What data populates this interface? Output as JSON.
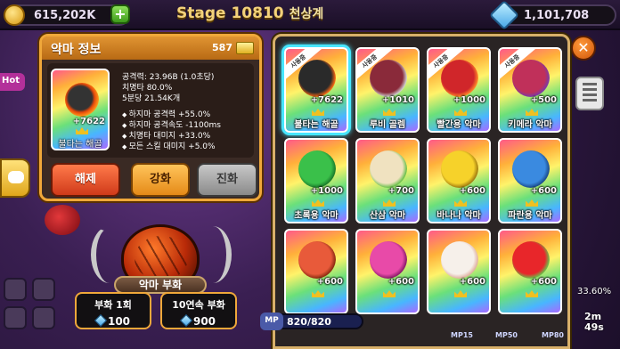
{
  "hud": {
    "gold": "615,202K",
    "stage": "Stage 10810",
    "stage_name": "천상계",
    "gems": "1,101,708",
    "hot_label": "Hot",
    "mp": "820/820",
    "mp_tag": "MP",
    "skills": [
      "MP15",
      "MP50",
      "MP80"
    ],
    "timer": [
      "2m",
      "49s"
    ],
    "percent": "33.60%"
  },
  "info": {
    "title": "악마 정보",
    "count": "587",
    "portrait_level": "+7622",
    "portrait_name": "불타는 해골",
    "stats": [
      "공격력: 23.96B (1.0초당)",
      "치명타 80.0%",
      "5분당 21.54K개"
    ],
    "buffs": [
      "하지마 공격력 +55.0%",
      "하지마 공격속도 -1100ms",
      "치명타 대미지 +33.0%",
      "모든 스킬 대미지 +5.0%"
    ],
    "buttons": {
      "release": "해제",
      "enhance": "강화",
      "evolve": "진화"
    }
  },
  "hatch": {
    "label": "악마 부화",
    "one": {
      "title": "부화 1회",
      "price": "100"
    },
    "ten": {
      "title": "10연속 부화",
      "price": "900"
    }
  },
  "grid": {
    "cards": [
      {
        "name": "불타는 해골",
        "level": "+7622",
        "ribbon": "사용중",
        "art": "#2a2a2a",
        "ring": "#ff6a12",
        "selected": true
      },
      {
        "name": "루비 골렘",
        "level": "+1010",
        "ribbon": "사용중",
        "art": "#8a2a3a",
        "ring": "#d0d0d0",
        "selected": false
      },
      {
        "name": "빨간용 악마",
        "level": "+1000",
        "ribbon": "사용중",
        "art": "#d0262a",
        "ring": "#ff8a2a",
        "selected": false
      },
      {
        "name": "키메라 악마",
        "level": "+500",
        "ribbon": "사용중",
        "art": "#c0305a",
        "ring": "#7a3aa8",
        "selected": false
      },
      {
        "name": "초록용 악마",
        "level": "+1000",
        "ribbon": "",
        "art": "#3ac04a",
        "ring": "#1a7a2a",
        "selected": false
      },
      {
        "name": "산삼 악마",
        "level": "+700",
        "ribbon": "",
        "art": "#f0e2c0",
        "ring": "#6ac04a",
        "selected": false
      },
      {
        "name": "바나나 악마",
        "level": "+600",
        "ribbon": "",
        "art": "#f6d22a",
        "ring": "#a07a10",
        "selected": false
      },
      {
        "name": "파란용 악마",
        "level": "+600",
        "ribbon": "",
        "art": "#3a8ae0",
        "ring": "#1a4a8a",
        "selected": false
      },
      {
        "name": "",
        "level": "+600",
        "ribbon": "",
        "art": "#e85a3a",
        "ring": "#8a2a10",
        "selected": false
      },
      {
        "name": "",
        "level": "+600",
        "ribbon": "",
        "art": "#e84aa8",
        "ring": "#8a1a6a",
        "selected": false
      },
      {
        "name": "",
        "level": "+600",
        "ribbon": "",
        "art": "#f6f0ea",
        "ring": "#e0b0a0",
        "selected": false
      },
      {
        "name": "",
        "level": "+600",
        "ribbon": "",
        "art": "#e8262a",
        "ring": "#6ac04a",
        "selected": false
      }
    ]
  }
}
